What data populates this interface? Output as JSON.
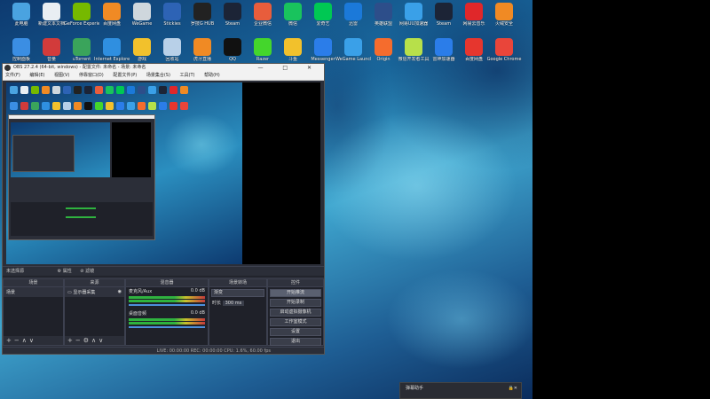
{
  "desktop": {
    "icons_row1": [
      {
        "label": "此电脑",
        "color": "#4aa3e0"
      },
      {
        "label": "新建文本文档",
        "color": "#e9eef3"
      },
      {
        "label": "GeForce Experience",
        "color": "#76b900"
      },
      {
        "label": "百度网盘",
        "color": "#f08a24"
      },
      {
        "label": "WeGame",
        "color": "#cfd7dd"
      },
      {
        "label": "Stickies",
        "color": "#2d63b5"
      },
      {
        "label": "罗技G HUB",
        "color": "#222222"
      },
      {
        "label": "Steam",
        "color": "#1c2436"
      },
      {
        "label": "企业微信",
        "color": "#e85d3c"
      },
      {
        "label": "微信",
        "color": "#19c35d"
      },
      {
        "label": "爱奇艺",
        "color": "#00c853"
      },
      {
        "label": "迅雷",
        "color": "#1b79d9"
      },
      {
        "label": "英雄联盟",
        "color": "#2d4e8a"
      },
      {
        "label": "网易UU加速器",
        "color": "#3aa0e8"
      },
      {
        "label": "Steam",
        "color": "#1c2436"
      },
      {
        "label": "网易云音乐",
        "color": "#e0272a"
      },
      {
        "label": "火绒安全",
        "color": "#f08a24"
      }
    ],
    "icons_row2": [
      {
        "label": "控制面板",
        "color": "#3b8ee3"
      },
      {
        "label": "音量",
        "color": "#d23b3b"
      },
      {
        "label": "uTorrent",
        "color": "#3aa45b"
      },
      {
        "label": "Internet Explorer",
        "color": "#2f8fe0"
      },
      {
        "label": "游戏",
        "color": "#f2c12c"
      },
      {
        "label": "回收站",
        "color": "#b8d0e8"
      },
      {
        "label": "虎牙直播",
        "color": "#f08a24"
      },
      {
        "label": "QQ",
        "color": "#111111"
      },
      {
        "label": "Razer",
        "color": "#44d62c"
      },
      {
        "label": "斗鱼",
        "color": "#f2c12c"
      },
      {
        "label": "Messenger",
        "color": "#2b7de9"
      },
      {
        "label": "WeGame Launcher",
        "color": "#3aa0e8"
      },
      {
        "label": "Origin",
        "color": "#f56c2d"
      },
      {
        "label": "微信开发者工具",
        "color": "#b7e04a"
      },
      {
        "label": "雷神加速器",
        "color": "#2b7de9"
      },
      {
        "label": "百度网盘",
        "color": "#e6362e"
      },
      {
        "label": "Google Chrome",
        "color": "#e9453a"
      }
    ]
  },
  "obs": {
    "title": "OBS 27.2.4 (64-bit, windows) - 配置文件: 未命名 - 场景: 未命名",
    "window_buttons": [
      "—",
      "□",
      "✕"
    ],
    "menu": [
      "文件(F)",
      "编辑(E)",
      "视图(V)",
      "停靠窗口(D)",
      "配置文件(P)",
      "场景集合(S)",
      "工具(T)",
      "帮助(H)"
    ],
    "source_bar": {
      "label": "未选择源",
      "props": "属性",
      "filters": "滤镜"
    },
    "scenes": {
      "header": "场景",
      "items": [
        "场景"
      ]
    },
    "sources": {
      "header": "来源",
      "items": [
        "显示器采集"
      ]
    },
    "mixer": {
      "header": "混音器",
      "channels": [
        {
          "name": "麦克风/Aux",
          "db": "0.0 dB"
        },
        {
          "name": "桌面音频",
          "db": "0.0 dB"
        }
      ]
    },
    "transitions": {
      "header": "场景转场",
      "type": "渐变",
      "duration_label": "时长",
      "duration": "300 ms"
    },
    "controls": {
      "header": "控件",
      "buttons": [
        "开始推流",
        "开始录制",
        "启动虚拟摄像机",
        "工作室模式",
        "设置",
        "退出"
      ]
    },
    "status": "LIVE: 00:00:00   REC: 00:00:00   CPU: 1.6%, 60.00 fps"
  },
  "widget": {
    "title": "弹幕助手"
  }
}
